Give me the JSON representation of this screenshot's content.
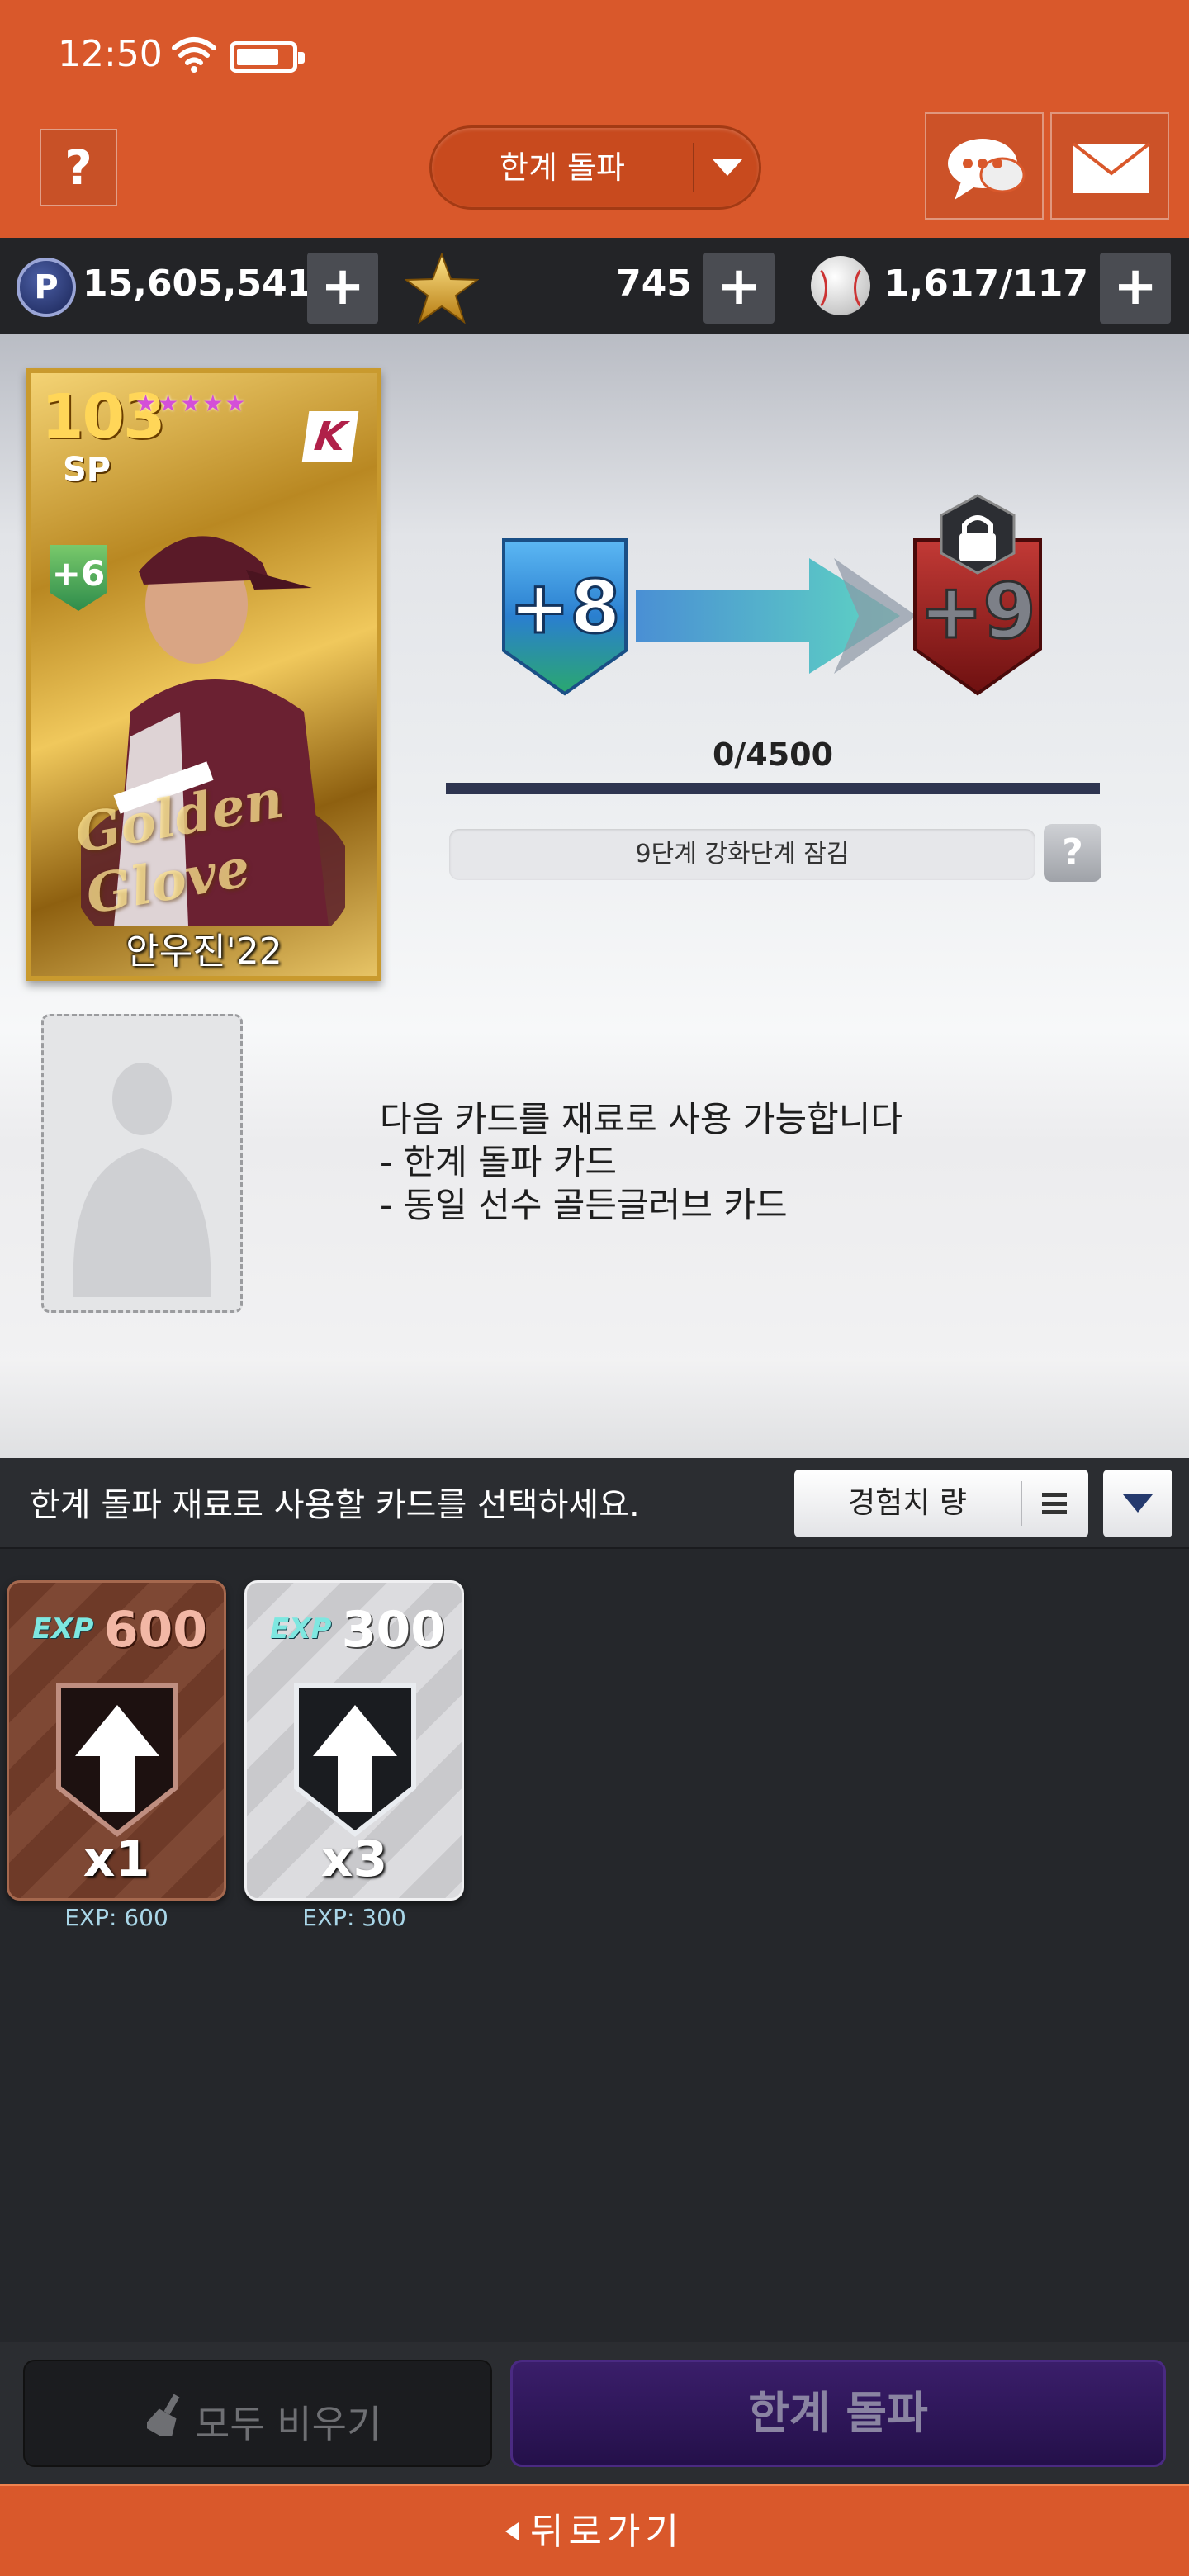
{
  "status_bar": {
    "time": "12:50",
    "battery_level": 0.8
  },
  "header": {
    "help_label": "?",
    "mode_dropdown_label": "한계 돌파",
    "icons": [
      "question-icon",
      "chat-icon",
      "mail-icon",
      "chevron-down-icon"
    ]
  },
  "currency": {
    "points_label": "P",
    "points": "15,605,541",
    "stars": "745",
    "balls": "1,617/117",
    "plus_label": "+"
  },
  "player_card": {
    "ovr": "103",
    "position": "SP",
    "stars": "★★★★★",
    "team_logo": "K",
    "level_badge": "+6",
    "name": "안우진'22",
    "series_text": "Golden Glove",
    "frame_color": "#c99a2e"
  },
  "upgrade": {
    "current_level": "+8",
    "next_level": "+9",
    "next_locked": true,
    "progress_text": "0/4500",
    "progress_fraction": 0,
    "lock_note": "9단계 강화단계 잠김",
    "lock_help_label": "?"
  },
  "material_info": {
    "line1": "다음 카드를 재료로 사용 가능합니다",
    "line2": "- 한계 돌파 카드",
    "line3": "- 동일 선수 골든글러브 카드"
  },
  "selection": {
    "hint": "한계 돌파 재료로 사용할 카드를 선택하세요.",
    "sort_label": "경험치 량"
  },
  "exp_cards": [
    {
      "tag": "EXP",
      "amount": "600",
      "quantity": "x1",
      "caption": "EXP: 600",
      "tier": "bronze"
    },
    {
      "tag": "EXP",
      "amount": "300",
      "quantity": "x3",
      "caption": "EXP: 300",
      "tier": "silver"
    }
  ],
  "buttons": {
    "clear_all": "모두 비우기",
    "limit_break": "한계 돌파",
    "back": "뒤로가기"
  },
  "colors": {
    "header": "#d9582b",
    "limit_break_button": "#2e1758",
    "current_badge": "#3a8fd8",
    "next_badge": "#9a1f1f"
  }
}
